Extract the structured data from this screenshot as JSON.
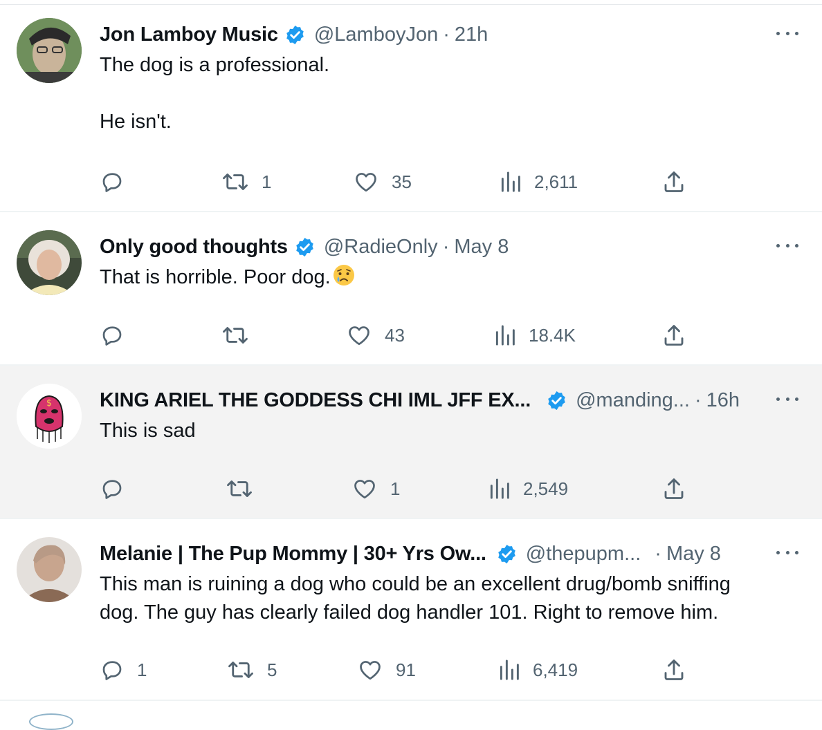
{
  "tweets": [
    {
      "name": "Jon Lamboy Music",
      "handle": "@LamboyJon",
      "time": "21h",
      "text": "The dog is a professional.\n\nHe isn't.",
      "replies": "",
      "retweets": "1",
      "likes": "35",
      "views": "2,611",
      "avatar_colors": [
        "#5f7f4f",
        "#c9b49a",
        "#2a2a2a"
      ]
    },
    {
      "name": "Only good thoughts",
      "handle": "@RadieOnly",
      "time": "May 8",
      "text": "That is horrible. Poor dog.",
      "emoji": "crying-face-emoji",
      "replies": "",
      "retweets": "",
      "likes": "43",
      "views": "18.4K",
      "avatar_colors": [
        "#3f4a3a",
        "#e9e2da",
        "#f3e9b8"
      ]
    },
    {
      "name": "KING ARIEL THE GODDESS CHI IML JFF EX...",
      "handle": "@manding...",
      "time": "16h",
      "text": "This is sad",
      "replies": "",
      "retweets": "",
      "likes": "1",
      "views": "2,549",
      "avatar_colors": [
        "#ffffff",
        "#d6336c",
        "#1a1a1a"
      ]
    },
    {
      "name": "Melanie | The Pup Mommy | 30+ Yrs Ow...",
      "handle": "@thepupm...",
      "time": "May 8",
      "text": "This man is ruining a dog who could be an excellent drug/bomb sniffing\ndog. The guy has clearly failed dog handler 101. Right to remove him.",
      "replies": "1",
      "retweets": "5",
      "likes": "91",
      "views": "6,419",
      "avatar_colors": [
        "#e4e0dc",
        "#c8a58e",
        "#8a6a55"
      ]
    }
  ],
  "dot_separator": "·",
  "icons": {
    "reply": "reply-icon",
    "retweet": "retweet-icon",
    "like": "heart-icon",
    "views": "views-icon",
    "share": "share-icon",
    "more": "more-icon",
    "verified": "verified-badge-icon"
  },
  "colors": {
    "verified": "#1d9bf0",
    "secondary_text": "#536471",
    "primary_text": "#0f1419",
    "highlight_bg": "#f3f3f3"
  }
}
